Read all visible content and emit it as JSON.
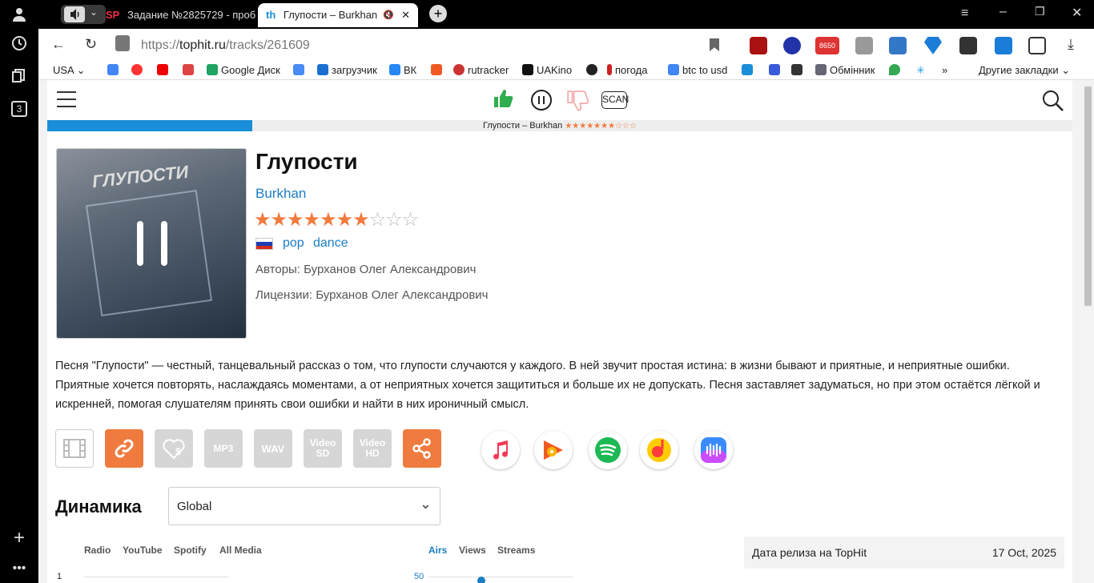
{
  "browser": {
    "tabs": [
      {
        "label": "Задание №2825729 - проб",
        "favicon": "SP"
      },
      {
        "label": "Глупости – Burkhan",
        "favicon": "th"
      }
    ],
    "url_prefix": "https://",
    "url_host": "tophit.ru",
    "url_path": "/tracks/261609",
    "side_badge": "3",
    "ext_badge": "8650"
  },
  "bookmarks": {
    "items": [
      "USA",
      "Google Диск",
      "загрузчик",
      "ВК",
      "rutracker",
      "UAKino",
      "погода",
      "btc to usd",
      "Обмінник"
    ],
    "other": "Другие закладки",
    "more": "»"
  },
  "site": {
    "scan_label": "SCAN",
    "now_playing": "Глупости – Burkhan",
    "now_playing_stars": "★★★★★★★☆☆☆",
    "progress_fraction": 0.2
  },
  "track": {
    "cover_text": "ГЛУПОСТИ",
    "title": "Глупости",
    "artist": "Burkhan",
    "rating": 7,
    "rating_max": 10,
    "genres": [
      "pop",
      "dance"
    ],
    "authors": "Авторы: Бурханов Олег Александрович",
    "licenses": "Лицензии: Бурханов Олег Александрович",
    "description": "Песня \"Глупости\" — честный, танцевальный рассказ о том, что глупости случаются у каждого. В ней звучит простая истина: в жизни бывают и приятные, и неприятные ошибки. Приятные хочется повторять, наслаждаясь моментами, а от неприятных хочется защититься и больше их не допускать. Песня заставляет задуматься, но при этом остаётся лёгкой и искренней, помогая слушателям принять свои ошибки и найти в них ироничный смысл."
  },
  "actions": {
    "mp3": "MP3",
    "wav": "WAV",
    "video_sd": "Video SD",
    "video_hd": "Video HD"
  },
  "colors": {
    "accent": "#f07b3f",
    "link": "#1a7dc2",
    "progress": "#1a8ed8",
    "thumb_green": "#2eae4e"
  },
  "dynamics": {
    "title": "Динамика",
    "select_value": "Global",
    "tabs_left": [
      "Radio",
      "YouTube",
      "Spotify",
      "All Media"
    ],
    "tabs_right": [
      "Airs",
      "Views",
      "Streams"
    ],
    "left_tick": "1",
    "right_tick": "50"
  },
  "release": {
    "label": "Дата релиза на TopHit",
    "value": "17 Oct, 2025"
  }
}
